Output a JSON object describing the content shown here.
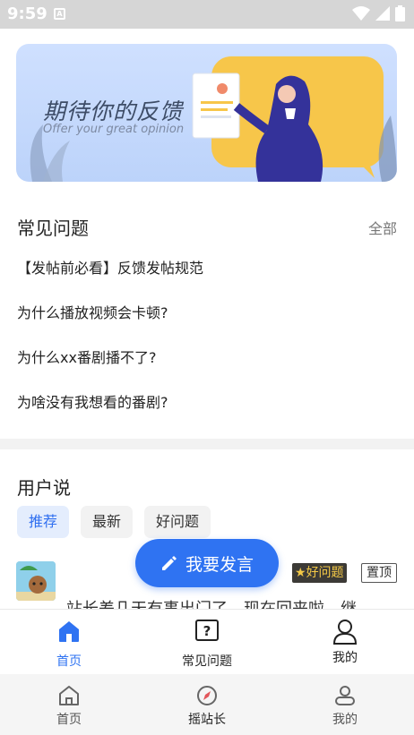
{
  "status_bar": {
    "time": "9:59",
    "notification_icon": "A"
  },
  "banner": {
    "title": "期待你的反馈",
    "subtitle": "Offer your great opinion"
  },
  "faq": {
    "heading": "常见问题",
    "all_link": "全部",
    "items": [
      "【发帖前必看】反馈发帖规范",
      "为什么播放视频会卡顿?",
      "为什么xx番剧播不了?",
      "为啥没有我想看的番剧?"
    ]
  },
  "user_says": {
    "heading": "用户说",
    "filters": [
      "推荐",
      "最新",
      "好问题"
    ],
    "active_filter": "推荐",
    "post": {
      "badge_good": "好问题",
      "badge_top": "置顶",
      "preview": "站长差几天有事出门了，现在回来啦，继"
    }
  },
  "fab": {
    "label": "我要发言",
    "icon": "pencil-icon"
  },
  "tab_bar": {
    "items": [
      {
        "label": "首页",
        "icon": "home-icon",
        "active": true
      },
      {
        "label": "常见问题",
        "icon": "question-icon",
        "active": false
      },
      {
        "label": "我的",
        "icon": "user-icon",
        "active": false
      }
    ]
  },
  "nav_bar": {
    "items": [
      {
        "label": "首页",
        "icon": "home-icon"
      },
      {
        "label": "摇站长",
        "icon": "compass-icon"
      },
      {
        "label": "我的",
        "icon": "user-icon"
      }
    ]
  },
  "colors": {
    "accent": "#2f73f2",
    "chip_active_bg": "#e4edfd",
    "banner_bg": "#c6daff"
  }
}
